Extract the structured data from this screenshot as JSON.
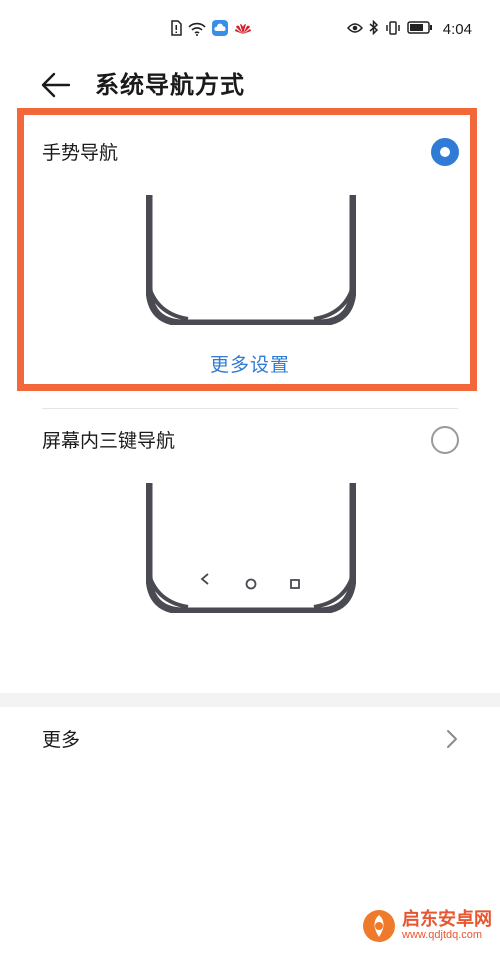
{
  "status_bar": {
    "time": "4:04",
    "icons": [
      "sim-alert-icon",
      "wifi-icon",
      "cloud-app-icon",
      "huawei-logo-icon",
      "eye-icon",
      "bluetooth-icon",
      "vibrate-icon",
      "battery-icon"
    ]
  },
  "header": {
    "title": "系统导航方式"
  },
  "options": [
    {
      "label": "手势导航",
      "selected": true,
      "more_link": "更多设置"
    },
    {
      "label": "屏幕内三键导航",
      "selected": false
    }
  ],
  "more_row": {
    "label": "更多"
  },
  "watermark": {
    "title": "启东安卓网",
    "url": "www.qdjtdq.com"
  },
  "colors": {
    "accent": "#2f7bd6",
    "highlight": "#f2683a",
    "phone_frame": "#4a4a52"
  }
}
